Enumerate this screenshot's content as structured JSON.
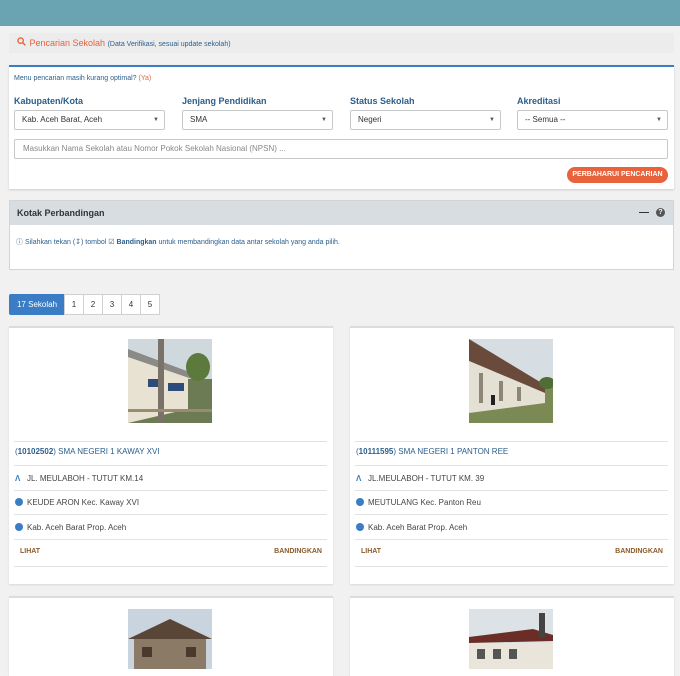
{
  "header": {
    "search_title": "Pencarian Sekolah",
    "search_subtitle": "(Data Verifikasi, sesuai update sekolah)"
  },
  "filters": {
    "hint_text": "Menu pencarian masih kurang optimal?",
    "hint_link": "(Ya)",
    "kabupaten": {
      "label": "Kabupaten/Kota",
      "value": "Kab. Aceh Barat, Aceh"
    },
    "jenjang": {
      "label": "Jenjang Pendidikan",
      "value": "SMA"
    },
    "status": {
      "label": "Status Sekolah",
      "value": "Negeri"
    },
    "akreditasi": {
      "label": "Akreditasi",
      "value": "-- Semua --"
    },
    "search_placeholder": "Masukkan Nama Sekolah atau Nomor Pokok Sekolah Nasional (NPSN) ...",
    "update_button": "PERBAHARUI PENCARIAN"
  },
  "compare_box": {
    "title": "Kotak Perbandingan",
    "text_1": "Silahkan tekan (",
    "text_2": ") tombol",
    "button_word": "Bandingkan",
    "text_3": "untuk membandingkan data antar sekolah yang anda pilih."
  },
  "pagination": {
    "count_label": "17 Sekolah",
    "pages": [
      "1",
      "2",
      "3",
      "4",
      "5"
    ]
  },
  "schools": [
    {
      "npsn": "10102502",
      "name": "SMA NEGERI 1 KAWAY XVI",
      "address": "JL. MEULABOH - TUTUT KM.14",
      "district": "KEUDE ARON Kec. Kaway XVI",
      "region": "Kab. Aceh Barat Prop. Aceh",
      "view_label": "LIHAT",
      "compare_label": "BANDINGKAN"
    },
    {
      "npsn": "10111595",
      "name": "SMA NEGERI 1 PANTON REE",
      "address": "JL.MEULABOH - TUTUT KM. 39",
      "district": "MEUTULANG Kec. Panton Reu",
      "region": "Kab. Aceh Barat Prop. Aceh",
      "view_label": "LIHAT",
      "compare_label": "BANDINGKAN"
    }
  ],
  "colors": {
    "accent_blue": "#3a7dc4",
    "accent_orange": "#e8623c",
    "topbar": "#6aa4b2"
  }
}
